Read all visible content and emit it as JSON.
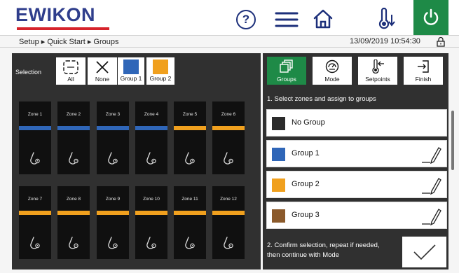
{
  "header": {
    "logo": "EWIKON",
    "help_glyph": "?",
    "icons": [
      "help-icon",
      "menu-icon",
      "home-icon",
      "temperature-icon",
      "power-icon"
    ]
  },
  "breadcrumb": "Setup ▸ Quick Start ▸ Groups",
  "datetime": "13/09/2019 10:54:30",
  "selection": {
    "label": "Selection",
    "buttons": [
      {
        "label": "All",
        "icon": "select-all-icon"
      },
      {
        "label": "None",
        "icon": "select-none-icon"
      },
      {
        "label": "Group 1",
        "color": "#2f66b8"
      },
      {
        "label": "Group 2",
        "color": "#f0a01e"
      }
    ]
  },
  "zones": [
    {
      "label": "Zone 1",
      "group_color": "#2f66b8"
    },
    {
      "label": "Zone 2",
      "group_color": "#2f66b8"
    },
    {
      "label": "Zone 3",
      "group_color": "#2f66b8"
    },
    {
      "label": "Zone 4",
      "group_color": "#2f66b8"
    },
    {
      "label": "Zone 5",
      "group_color": "#f0a01e"
    },
    {
      "label": "Zone 6",
      "group_color": "#f0a01e"
    },
    {
      "label": "Zone 7",
      "group_color": "#f0a01e"
    },
    {
      "label": "Zone 8",
      "group_color": "#f0a01e"
    },
    {
      "label": "Zone 9",
      "group_color": "#f0a01e"
    },
    {
      "label": "Zone 10",
      "group_color": "#f0a01e"
    },
    {
      "label": "Zone 11",
      "group_color": "#f0a01e"
    },
    {
      "label": "Zone 12",
      "group_color": "#f0a01e"
    }
  ],
  "tabs": [
    {
      "label": "Groups",
      "icon": "groups-icon",
      "active": true
    },
    {
      "label": "Mode",
      "icon": "mode-icon",
      "active": false
    },
    {
      "label": "Setpoints",
      "icon": "setpoints-icon",
      "active": false
    },
    {
      "label": "Finish",
      "icon": "finish-icon",
      "active": false
    }
  ],
  "step1": "1. Select zones and assign to groups",
  "groups": [
    {
      "name": "No Group",
      "color": "#2b2b2b",
      "editable": false
    },
    {
      "name": "Group 1",
      "color": "#2f66b8",
      "editable": true
    },
    {
      "name": "Group 2",
      "color": "#f0a01e",
      "editable": true
    },
    {
      "name": "Group 3",
      "color": "#8b5a2b",
      "editable": true
    }
  ],
  "step2": "2. Confirm selection, repeat if needed, then continue with Mode",
  "colors": {
    "accent_green": "#1e8a47",
    "brand_blue": "#2f3e8c",
    "brand_red": "#d6232b",
    "panel": "#303030"
  }
}
